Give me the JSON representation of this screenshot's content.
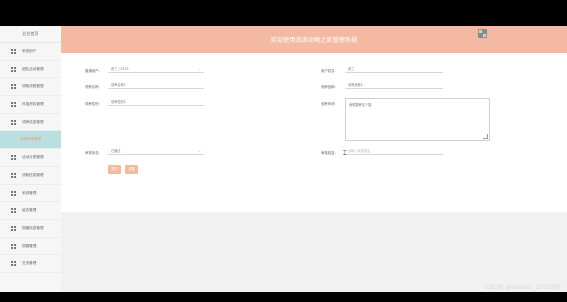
{
  "sidebar": {
    "title": "后台首页",
    "items": [
      {
        "label": "系统用户",
        "icon": "grid-icon"
      },
      {
        "label": "团队活动管理",
        "icon": "grid-icon"
      },
      {
        "label": "领取流程管理",
        "icon": "grid-icon"
      },
      {
        "label": "科普资料管理",
        "icon": "grid-icon"
      },
      {
        "label": "领养信息管理",
        "icon": "grid-icon"
      },
      {
        "label": "领养申请管理",
        "icon": "grid-icon",
        "active": true
      },
      {
        "label": "活动分类管理",
        "icon": "grid-icon"
      },
      {
        "label": "领取信息管理",
        "icon": "grid-icon"
      },
      {
        "label": "系统管理",
        "icon": "grid-icon"
      },
      {
        "label": "留言管理",
        "icon": "grid-icon"
      },
      {
        "label": "捐赠信息管理",
        "icon": "grid-icon"
      },
      {
        "label": "捐赠管理",
        "icon": "grid-icon"
      },
      {
        "label": "交流管理",
        "icon": "grid-icon"
      }
    ]
  },
  "header": {
    "title": "欢迎使用流浪动物之家管理系统",
    "user_icon": "avatar-icon",
    "color": "#f4b9a3"
  },
  "form": {
    "left": [
      {
        "label": "普通用户:",
        "value": "张三 / 0233",
        "type": "select"
      },
      {
        "label": "领养名称:",
        "value": "领养名称1",
        "type": "input"
      },
      {
        "label": "领养性别:",
        "value": "领养性别2",
        "type": "input"
      }
    ],
    "right": [
      {
        "label": "用户姓名:",
        "value": "张三",
        "type": "input"
      },
      {
        "label": "领养品种:",
        "value": "领养品种2",
        "type": "input"
      }
    ],
    "application_reason": {
      "label": "领养申请:",
      "value": "我想要养这个猫"
    },
    "review_status": {
      "label": "审核状态:",
      "value": "已通过",
      "type": "select"
    },
    "review_reply": {
      "label": "审核回复:",
      "placeholder": "请输入审核回复"
    },
    "buttons": {
      "submit": "提交",
      "reset": "重置"
    }
  },
  "watermark": "CSDN @weixin_ZY1008"
}
